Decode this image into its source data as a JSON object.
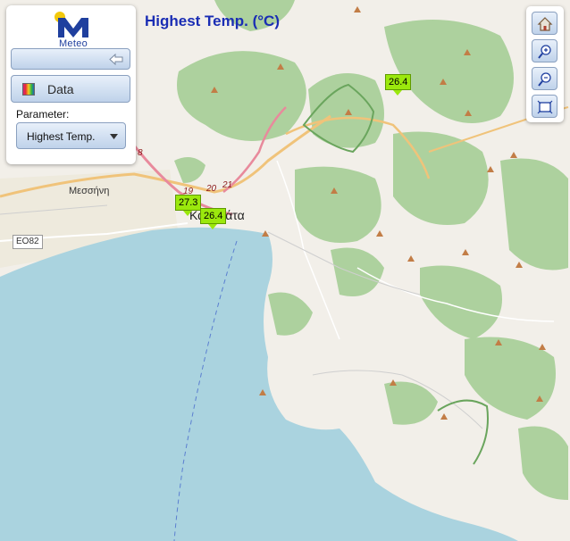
{
  "app": {
    "logo_text": "Meteo",
    "title": "Highest Temp. (°C)"
  },
  "panel": {
    "data_label": "Data",
    "parameter_label": "Parameter:",
    "parameter_value": "Highest Temp."
  },
  "toolbar": {
    "icons": [
      "home-icon",
      "zoom-in-icon",
      "zoom-out-icon",
      "extent-icon"
    ]
  },
  "stations": [
    {
      "value": "26.4"
    },
    {
      "value": "27.3"
    },
    {
      "value": "26.4"
    }
  ],
  "map": {
    "place_messini": "Μεσσήνη",
    "place_kalamata": "Καλαμάτα",
    "road_badge": "EO82",
    "road_nums": [
      "8",
      "19",
      "20",
      "21"
    ]
  },
  "colors": {
    "sea": "#aad3df",
    "land": "#f2efe9",
    "forest": "#add19e",
    "marker": "#9be80d",
    "title": "#1a2db4"
  }
}
